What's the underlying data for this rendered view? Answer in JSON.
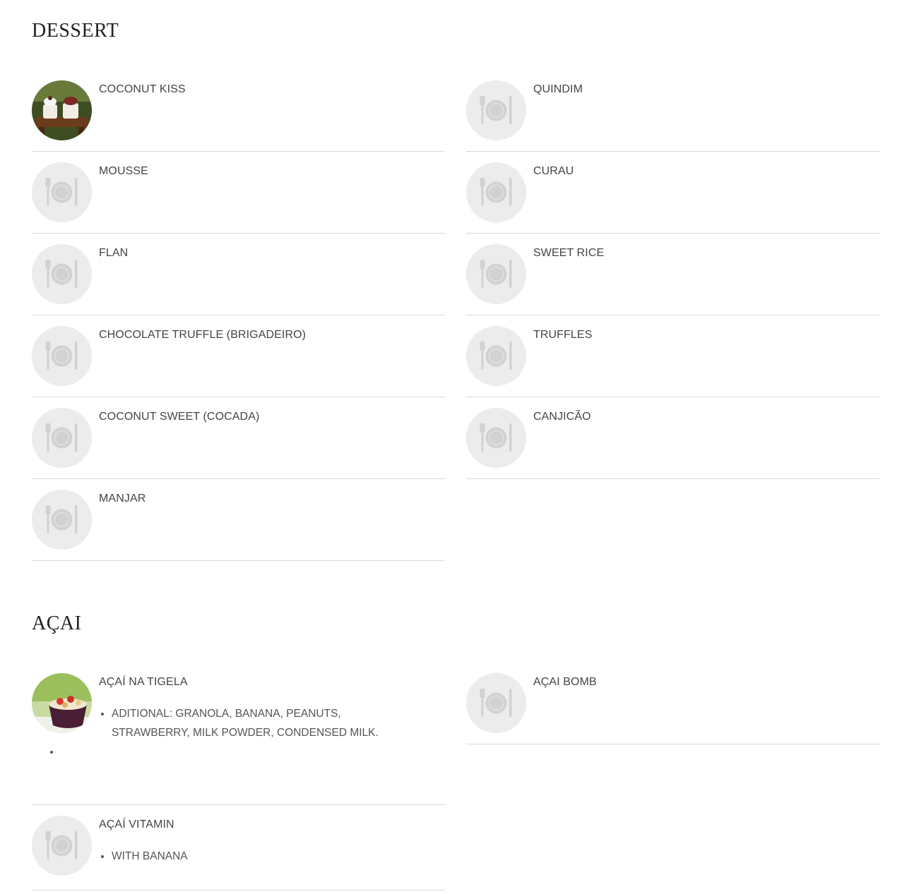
{
  "sections": [
    {
      "title": "DESSERT",
      "items": [
        {
          "name": "COCONUT KISS",
          "photo": "coconut-kiss-photo"
        },
        {
          "name": "QUINDIM"
        },
        {
          "name": "MOUSSE"
        },
        {
          "name": "CURAU"
        },
        {
          "name": "FLAN"
        },
        {
          "name": "SWEET RICE"
        },
        {
          "name": "CHOCOLATE TRUFFLE (BRIGADEIRO)"
        },
        {
          "name": "TRUFFLES"
        },
        {
          "name": "COCONUT SWEET (COCADA)"
        },
        {
          "name": "CANJICÃO"
        },
        {
          "name": "MANJAR"
        }
      ]
    },
    {
      "title": "AÇAI",
      "items": [
        {
          "name": "AÇAÍ NA TIGELA",
          "photo": "acai-bowl-photo",
          "description": [
            "ADITIONAL: GRANOLA, BANANA, PEANUTS, STRAWBERRY, MILK POWDER, CONDENSED MILK.",
            ""
          ]
        },
        {
          "name": "AÇAI BOMB"
        },
        {
          "name": "AÇAÍ VITAMIN",
          "description": [
            "WITH BANANA"
          ]
        }
      ]
    }
  ],
  "placeholder_icon": "plate-fork-knife-icon"
}
